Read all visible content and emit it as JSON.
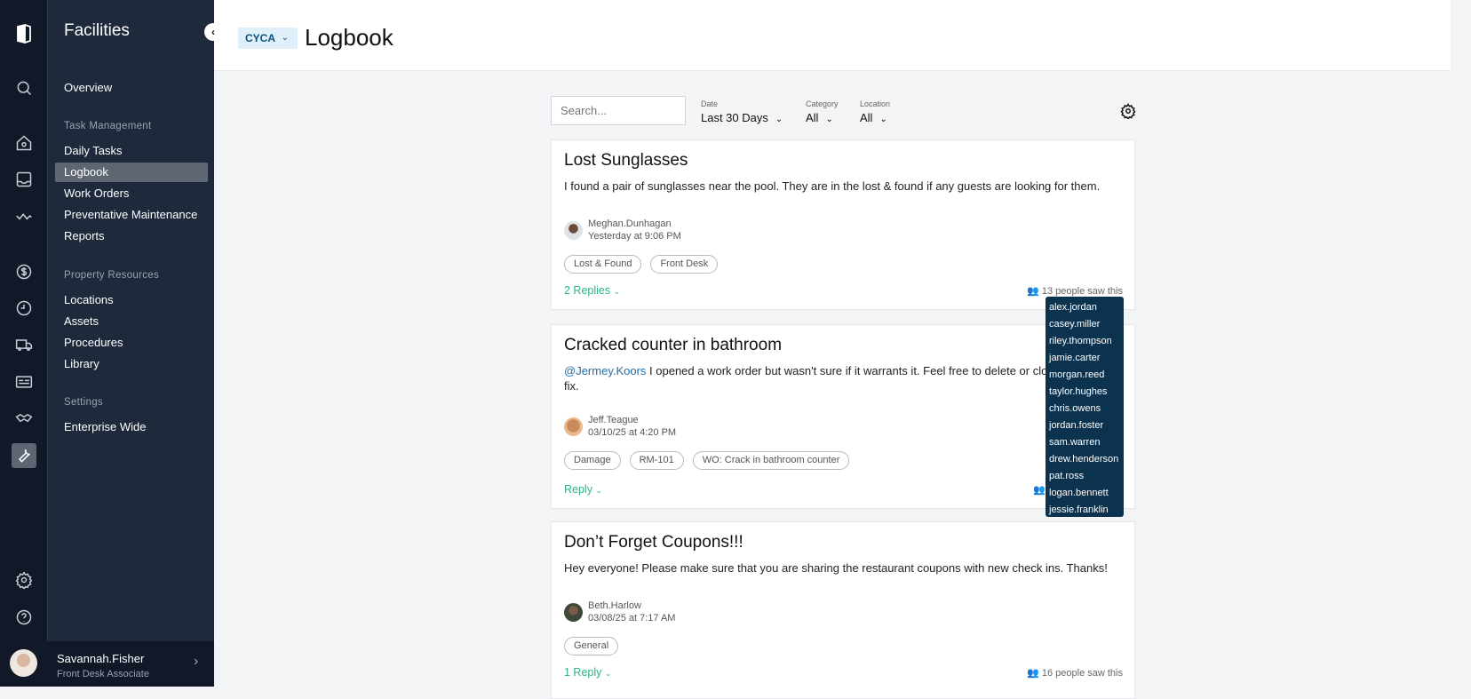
{
  "rail": {
    "icons": [
      "logo-icon",
      "search-icon",
      "home-icon",
      "inbox-icon",
      "activity-icon",
      "dollar-icon",
      "clock-icon",
      "truck-icon",
      "id-card-icon",
      "handshake-icon",
      "wrench-icon",
      "gear-icon",
      "help-icon"
    ]
  },
  "sidebar": {
    "title": "Facilities",
    "overview": "Overview",
    "sections": [
      {
        "label": "Task Management",
        "items": [
          "Daily Tasks",
          "Logbook",
          "Work Orders",
          "Preventative Maintenance",
          "Reports"
        ]
      },
      {
        "label": "Property Resources",
        "items": [
          "Locations",
          "Assets",
          "Procedures",
          "Library"
        ]
      },
      {
        "label": "Settings",
        "items": [
          "Enterprise Wide"
        ]
      }
    ],
    "active": "Logbook",
    "user": {
      "name": "Savannah.Fisher",
      "role": "Front Desk Associate"
    }
  },
  "header": {
    "property": "CYCA",
    "title": "Logbook"
  },
  "filters": {
    "search_placeholder": "Search...",
    "date": {
      "label": "Date",
      "value": "Last 30 Days"
    },
    "category": {
      "label": "Category",
      "value": "All"
    },
    "location": {
      "label": "Location",
      "value": "All"
    }
  },
  "posts": [
    {
      "title": "Lost Sunglasses",
      "mention": "",
      "body": "I found a pair of sunglasses near the pool. They are in the lost & found if any guests are looking for them.",
      "author": "Meghan.Dunhagan",
      "date": "Yesterday at 9:06 PM",
      "tags": [
        "Lost & Found",
        "Front Desk"
      ],
      "replies": "2 Replies",
      "seen": "13 people saw this"
    },
    {
      "title": "Cracked counter in bathroom",
      "mention": "@Jermey.Koors",
      "body": " I opened a work order but wasn't sure if it warrants it. Feel free to delete or close another fix.",
      "author": "Jeff.Teague",
      "date": "03/10/25 at 4:20 PM",
      "tags": [
        "Damage",
        "RM-101",
        "WO: Crack in bathroom counter"
      ],
      "replies": "Reply",
      "seen": ""
    },
    {
      "title": "Don’t Forget Coupons!!!",
      "mention": "",
      "body": "Hey everyone! Please make sure that you are sharing the restaurant coupons with new check ins. Thanks!",
      "author": "Beth.Harlow",
      "date": "03/08/25 at 7:17 AM",
      "tags": [
        "General"
      ],
      "replies": "1 Reply",
      "seen": "16 people saw this"
    }
  ],
  "seen_tooltip": [
    "alex.jordan",
    "casey.miller",
    "riley.thompson",
    "jamie.carter",
    "morgan.reed",
    "taylor.hughes",
    "chris.owens",
    "jordan.foster",
    "sam.warren",
    "drew.henderson",
    "pat.ross",
    "logan.bennett",
    "jessie.franklin"
  ]
}
